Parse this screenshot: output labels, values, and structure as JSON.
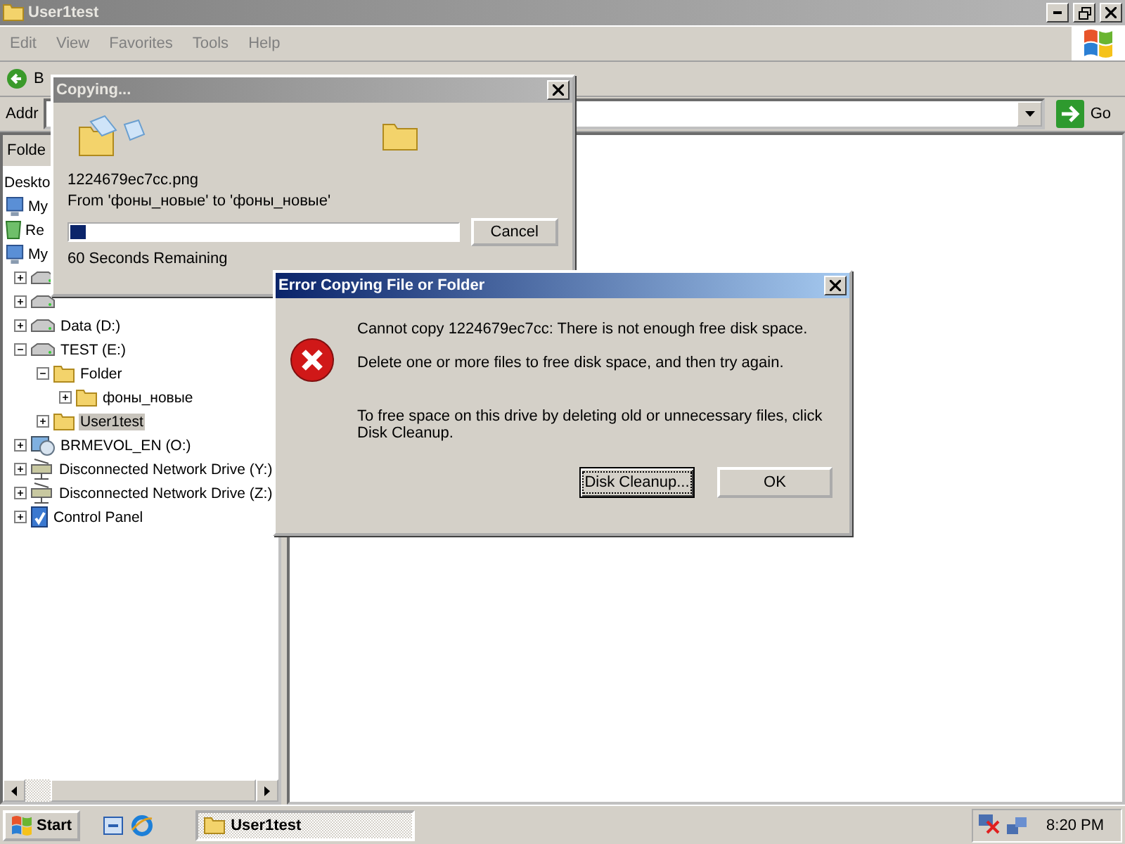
{
  "window": {
    "title": "User1test",
    "active": false
  },
  "menu": [
    "Edit",
    "View",
    "Favorites",
    "Tools",
    "Help"
  ],
  "toolbar": {
    "back_label": "B"
  },
  "address": {
    "label": "Addr",
    "go": "Go"
  },
  "folders_pane": {
    "title": "Folde",
    "tree": [
      {
        "label": "Deskto",
        "kind": "text",
        "selected": false
      },
      {
        "label": "My",
        "kind": "computer",
        "selected": false
      },
      {
        "label": "Re",
        "kind": "recycle",
        "selected": false
      },
      {
        "label": "My",
        "kind": "computer",
        "selected": false
      },
      {
        "kind": "drive",
        "expanded": false
      },
      {
        "kind": "drive",
        "expanded": false
      },
      {
        "label": "Data (D:)",
        "kind": "drive",
        "expanded": false,
        "selected": false
      },
      {
        "label": "TEST (E:)",
        "kind": "drive",
        "expanded": true,
        "selected": false,
        "children": [
          {
            "label": "Folder",
            "kind": "folder",
            "expanded": true,
            "selected": false,
            "children": [
              {
                "label": "фоны_новые",
                "kind": "folder",
                "expanded": false,
                "selected": false
              }
            ]
          },
          {
            "label": "User1test",
            "kind": "folder",
            "expanded": false,
            "selected": true
          }
        ]
      },
      {
        "label": "BRMEVOL_EN (O:)",
        "kind": "disc",
        "expanded": false,
        "selected": false
      },
      {
        "label": "Disconnected Network Drive (Y:)",
        "kind": "netdrive",
        "expanded": false,
        "selected": false
      },
      {
        "label": "Disconnected Network Drive (Z:)",
        "kind": "netdrive",
        "expanded": false,
        "selected": false
      },
      {
        "label": "Control Panel",
        "kind": "control",
        "expanded": false,
        "selected": false
      }
    ]
  },
  "copy_dialog": {
    "title": "Copying...",
    "active": false,
    "file": "1224679ec7cc.png",
    "from": "From 'фоны_новые' to 'фоны_новые'",
    "level": 0.04,
    "cancel": "Cancel",
    "remaining": "60 Seconds Remaining"
  },
  "error_dialog": {
    "title": "Error Copying File or Folder",
    "active": true,
    "messages": [
      "Cannot copy 1224679ec7cc: There is not enough free disk space.",
      "Delete one or more files to free disk space, and then try again.",
      "To free space on this drive by deleting old or unnecessary files, click Disk Cleanup."
    ],
    "buttons": [
      {
        "label": "Disk Cleanup...",
        "default": true
      },
      {
        "label": "OK",
        "default": false
      }
    ]
  },
  "taskbar": {
    "start": "Start",
    "tasks": [
      {
        "label": "User1test",
        "selected": true
      }
    ],
    "clock": "8:20 PM"
  }
}
